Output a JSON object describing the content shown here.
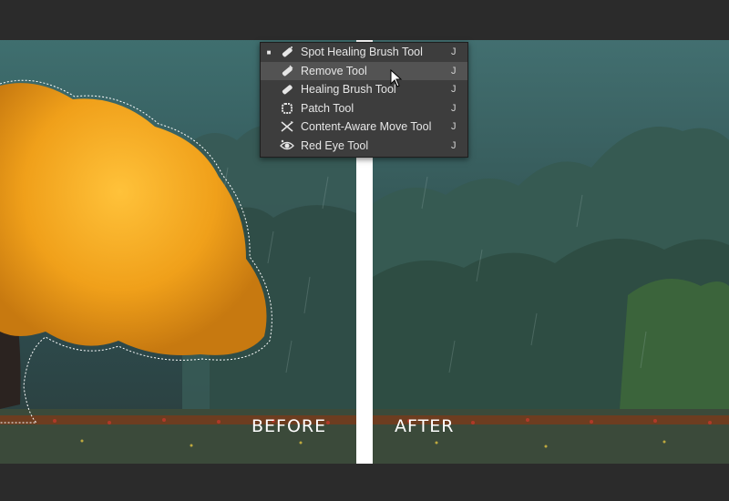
{
  "labels": {
    "before": "BEFORE",
    "after": "AFTER"
  },
  "tool_menu": {
    "items": [
      {
        "name": "Spot Healing Brush Tool",
        "shortcut": "J",
        "icon": "spot-healing-brush-icon",
        "active": true,
        "highlighted": false
      },
      {
        "name": "Remove Tool",
        "shortcut": "J",
        "icon": "remove-tool-icon",
        "active": false,
        "highlighted": true
      },
      {
        "name": "Healing Brush Tool",
        "shortcut": "J",
        "icon": "healing-brush-icon",
        "active": false,
        "highlighted": false
      },
      {
        "name": "Patch Tool",
        "shortcut": "J",
        "icon": "patch-tool-icon",
        "active": false,
        "highlighted": false
      },
      {
        "name": "Content-Aware Move Tool",
        "shortcut": "J",
        "icon": "content-aware-move-icon",
        "active": false,
        "highlighted": false
      },
      {
        "name": "Red Eye Tool",
        "shortcut": "J",
        "icon": "red-eye-icon",
        "active": false,
        "highlighted": false
      }
    ]
  },
  "colors": {
    "chrome": "#2b2b2b",
    "menu_bg": "#3d3d3d",
    "menu_highlight": "#535353",
    "tree_foliage": "#e8a317",
    "forest": "#3c5a55"
  }
}
